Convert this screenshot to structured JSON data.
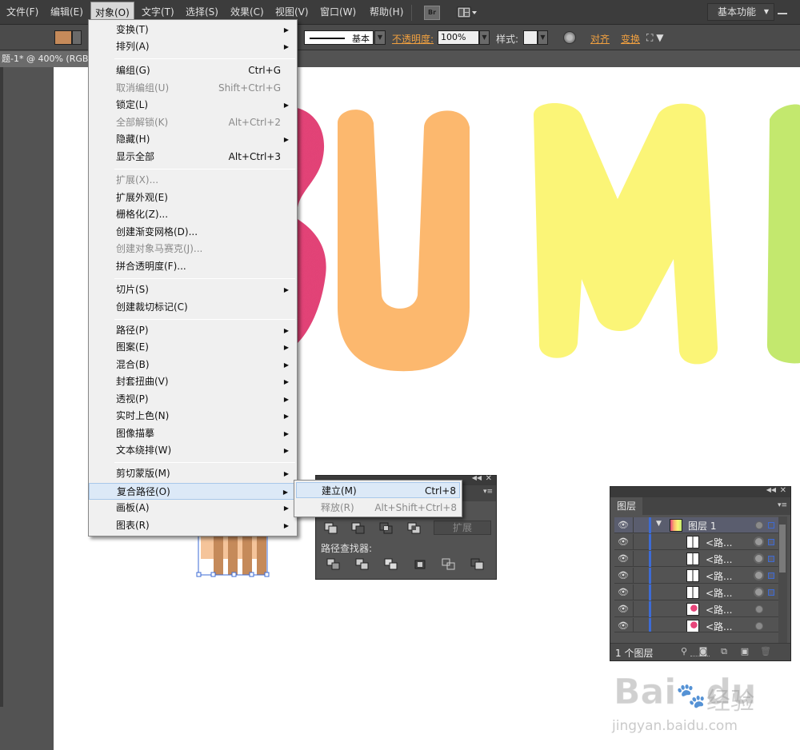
{
  "menubar": {
    "items": [
      "文件(F)",
      "编辑(E)",
      "对象(O)",
      "文字(T)",
      "选择(S)",
      "效果(C)",
      "视图(V)",
      "窗口(W)",
      "帮助(H)"
    ],
    "br_label": "Br",
    "workspace": "基本功能"
  },
  "controlbar": {
    "fill_color": "#c58a5a",
    "stroke_style": "基本",
    "opacity_label": "不透明度:",
    "opacity_value": "100%",
    "style_label": "样式:",
    "align_label": "对齐",
    "transform_label": "变换"
  },
  "document": {
    "tab_title": "题-1* @ 400% (RGB"
  },
  "canvas": {
    "letters": [
      "S",
      "U",
      "M",
      "M"
    ],
    "colors": [
      "#e8457a",
      "#fcb86e",
      "#fbf577",
      "#c3e86e"
    ]
  },
  "object_menu": {
    "items": [
      {
        "label": "变换(T)",
        "shortcut": "",
        "submenu": true,
        "disabled": false
      },
      {
        "label": "排列(A)",
        "shortcut": "",
        "submenu": true,
        "disabled": false
      },
      {
        "label": "编组(G)",
        "shortcut": "Ctrl+G",
        "submenu": false,
        "disabled": false
      },
      {
        "label": "取消编组(U)",
        "shortcut": "Shift+Ctrl+G",
        "submenu": false,
        "disabled": true
      },
      {
        "label": "锁定(L)",
        "shortcut": "",
        "submenu": true,
        "disabled": false
      },
      {
        "label": "全部解锁(K)",
        "shortcut": "Alt+Ctrl+2",
        "submenu": false,
        "disabled": true
      },
      {
        "label": "隐藏(H)",
        "shortcut": "",
        "submenu": true,
        "disabled": false
      },
      {
        "label": "显示全部",
        "shortcut": "Alt+Ctrl+3",
        "submenu": false,
        "disabled": false
      },
      {
        "label": "扩展(X)...",
        "shortcut": "",
        "submenu": false,
        "disabled": true
      },
      {
        "label": "扩展外观(E)",
        "shortcut": "",
        "submenu": false,
        "disabled": false
      },
      {
        "label": "栅格化(Z)...",
        "shortcut": "",
        "submenu": false,
        "disabled": false
      },
      {
        "label": "创建渐变网格(D)...",
        "shortcut": "",
        "submenu": false,
        "disabled": false
      },
      {
        "label": "创建对象马赛克(J)...",
        "shortcut": "",
        "submenu": false,
        "disabled": true
      },
      {
        "label": "拼合透明度(F)...",
        "shortcut": "",
        "submenu": false,
        "disabled": false
      },
      {
        "label": "切片(S)",
        "shortcut": "",
        "submenu": true,
        "disabled": false
      },
      {
        "label": "创建裁切标记(C)",
        "shortcut": "",
        "submenu": false,
        "disabled": false
      },
      {
        "label": "路径(P)",
        "shortcut": "",
        "submenu": true,
        "disabled": false
      },
      {
        "label": "图案(E)",
        "shortcut": "",
        "submenu": true,
        "disabled": false
      },
      {
        "label": "混合(B)",
        "shortcut": "",
        "submenu": true,
        "disabled": false
      },
      {
        "label": "封套扭曲(V)",
        "shortcut": "",
        "submenu": true,
        "disabled": false
      },
      {
        "label": "透视(P)",
        "shortcut": "",
        "submenu": true,
        "disabled": false
      },
      {
        "label": "实时上色(N)",
        "shortcut": "",
        "submenu": true,
        "disabled": false
      },
      {
        "label": "图像描摹",
        "shortcut": "",
        "submenu": true,
        "disabled": false
      },
      {
        "label": "文本绕排(W)",
        "shortcut": "",
        "submenu": true,
        "disabled": false
      },
      {
        "label": "剪切蒙版(M)",
        "shortcut": "",
        "submenu": true,
        "disabled": false
      },
      {
        "label": "复合路径(O)",
        "shortcut": "",
        "submenu": true,
        "disabled": false,
        "highlighted": true
      },
      {
        "label": "画板(A)",
        "shortcut": "",
        "submenu": true,
        "disabled": false
      },
      {
        "label": "图表(R)",
        "shortcut": "",
        "submenu": true,
        "disabled": false
      }
    ]
  },
  "compound_submenu": {
    "items": [
      {
        "label": "建立(M)",
        "shortcut": "Ctrl+8",
        "disabled": false
      },
      {
        "label": "释放(R)",
        "shortcut": "Alt+Shift+Ctrl+8",
        "disabled": true
      }
    ]
  },
  "pathfinder": {
    "expand_label": "扩展",
    "section_label": "路径查找器:"
  },
  "layers": {
    "tab": "图层",
    "rows": [
      {
        "name": "图层 1",
        "thumb": "layer"
      },
      {
        "name": "<路...",
        "thumb": "rect"
      },
      {
        "name": "<路...",
        "thumb": "rect"
      },
      {
        "name": "<路...",
        "thumb": "rect"
      },
      {
        "name": "<路...",
        "thumb": "rect"
      },
      {
        "name": "<路...",
        "thumb": "pink"
      },
      {
        "name": "<路...",
        "thumb": "pink"
      }
    ],
    "count": "1 个图层"
  },
  "watermark": {
    "brand": "Bai",
    "brand2": "du",
    "cn": "经验",
    "url": "jingyan.baidu.com"
  }
}
